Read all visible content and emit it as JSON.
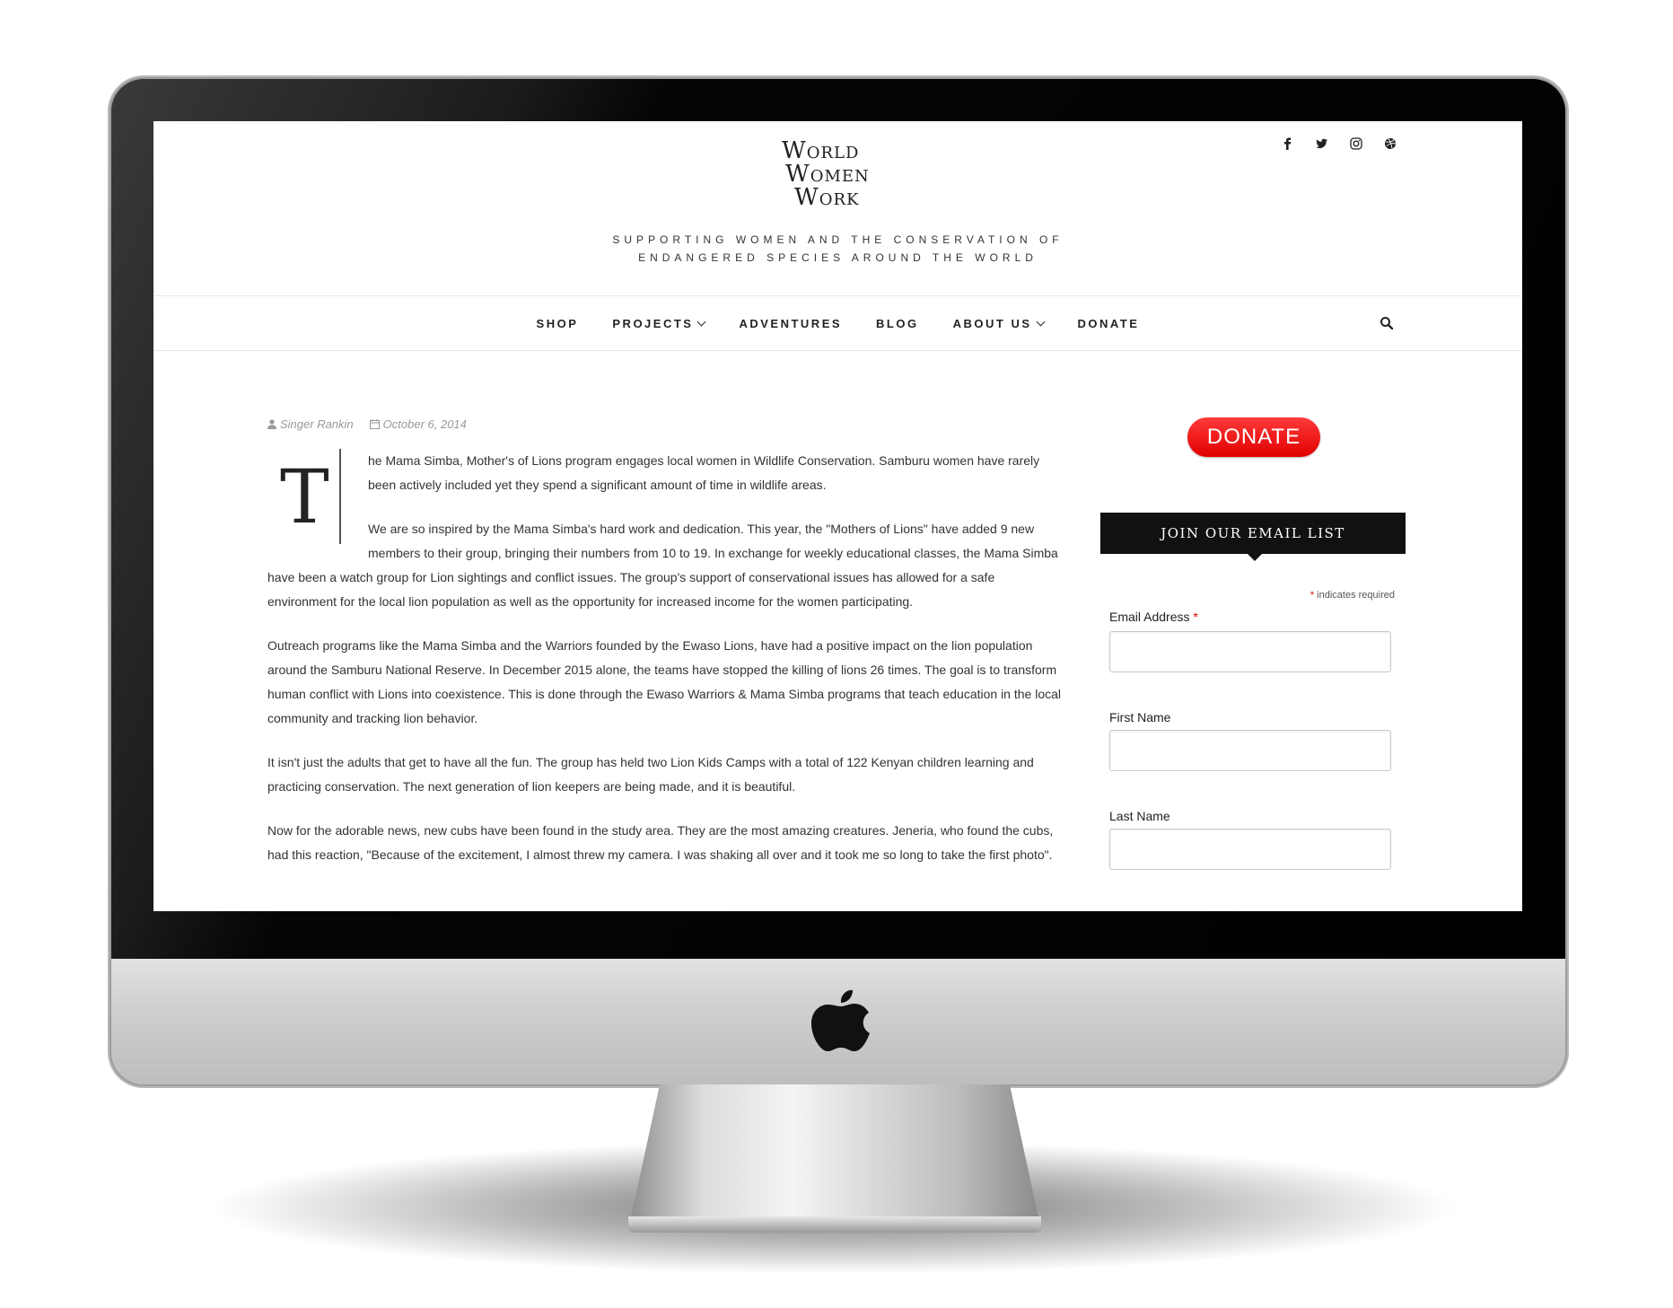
{
  "site": {
    "logo_lines": [
      "World",
      "Women",
      "Work"
    ],
    "tagline_line1": "SUPPORTING WOMEN AND THE CONSERVATION OF",
    "tagline_line2": "ENDANGERED SPECIES AROUND THE WORLD",
    "social_icons": [
      "facebook-icon",
      "twitter-icon",
      "instagram-icon",
      "dribbble-icon"
    ]
  },
  "nav": {
    "items": [
      {
        "label": "SHOP",
        "dropdown": false
      },
      {
        "label": "PROJECTS",
        "dropdown": true
      },
      {
        "label": "ADVENTURES",
        "dropdown": false
      },
      {
        "label": "BLOG",
        "dropdown": false
      },
      {
        "label": "ABOUT US",
        "dropdown": true
      },
      {
        "label": "DONATE",
        "dropdown": false
      }
    ]
  },
  "article": {
    "author": "Singer Rankin",
    "date": "October 6, 2014",
    "dropcap": "T",
    "paragraphs": [
      "he Mama Simba, Mother's of Lions  program engages local women in Wildlife Conservation. Samburu women have rarely been actively included yet they spend a significant amount of time in wildlife areas.",
      "We are so inspired by the Mama Simba's hard work and dedication. This year, the \"Mothers of Lions\" have added 9 new members to their group, bringing their numbers from 10 to 19. In exchange for weekly educational classes, the Mama Simba have been a watch group for Lion sightings and conflict issues. The group's support of conservational issues has allowed for a safe environment for the local lion population as well as the opportunity for increased income for the women participating.",
      "Outreach programs like the Mama Simba and the Warriors founded by the Ewaso Lions, have had a positive impact on the lion population around the Samburu National Reserve. In December 2015 alone, the teams have stopped the killing of lions 26 times. The goal is to transform human conflict with Lions into coexistence. This is done through the Ewaso Warriors & Mama Simba programs that teach education in the local community and tracking lion behavior.",
      "It isn't just the adults that get to have all the fun. The group has held two Lion Kids Camps with a total of 122 Kenyan children learning and practicing conservation. The next generation of lion keepers are being made, and it is beautiful.",
      "Now for the adorable news, new cubs have been found in the study area. They are the most amazing creatures. Jeneria, who found the cubs, had this reaction, \"Because of the excitement, I almost threw my camera. I was shaking all over and it took me so long to take the first photo\"."
    ]
  },
  "sidebar": {
    "donate_label": "DONATE",
    "email_title": "JOIN OUR EMAIL LIST",
    "required_note": "indicates required",
    "fields": [
      {
        "label": "Email Address",
        "required": true,
        "value": ""
      },
      {
        "label": "First Name",
        "required": false,
        "value": ""
      },
      {
        "label": "Last Name",
        "required": false,
        "value": ""
      }
    ]
  },
  "colors": {
    "donate_red": "#e00000",
    "header_black": "#111111",
    "text": "#333333"
  }
}
